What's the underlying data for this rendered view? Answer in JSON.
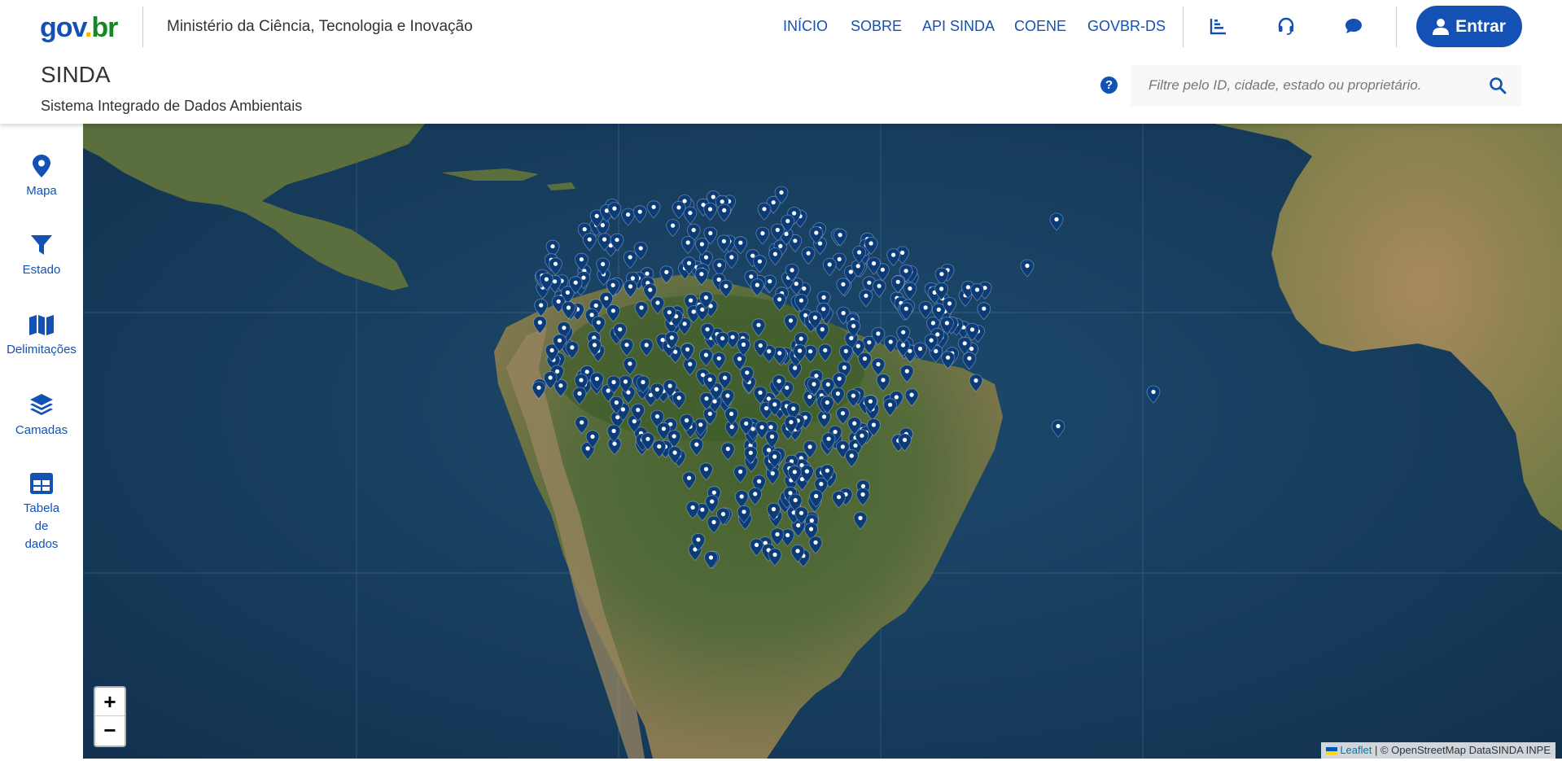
{
  "header": {
    "logo": {
      "part1": "gov",
      "part2": ".",
      "part3": "br"
    },
    "org_name": "Ministério da Ciência, Tecnologia e Inovação",
    "nav": [
      "INÍCIO",
      "SOBRE",
      "API SINDA",
      "COENE",
      "GOVBR-DS"
    ],
    "login_label": "Entrar",
    "app_title": "SINDA",
    "app_subtitle": "Sistema Integrado de Dados Ambientais",
    "help_label": "?",
    "search_placeholder": "Filtre pelo ID, cidade, estado ou proprietário."
  },
  "sidebar": {
    "items": [
      {
        "label": "Mapa",
        "icon": "map-marker-icon"
      },
      {
        "label": "Estado",
        "icon": "filter-icon"
      },
      {
        "label": "Delimitações",
        "icon": "map-icon"
      },
      {
        "label": "Camadas",
        "icon": "layers-icon"
      },
      {
        "label": "Tabela de dados",
        "line1": "Tabela",
        "line2": "de",
        "line3": "dados",
        "icon": "table-icon"
      }
    ]
  },
  "map": {
    "zoom_in": "+",
    "zoom_out": "−",
    "attribution_link": "Leaflet",
    "attribution_text": "| © OpenStreetMap DataSINDA INPE"
  },
  "colors": {
    "primary": "#1351b4",
    "marker": "#0c3c78",
    "ocean": "#183f60",
    "land": "#4e6a3a"
  }
}
